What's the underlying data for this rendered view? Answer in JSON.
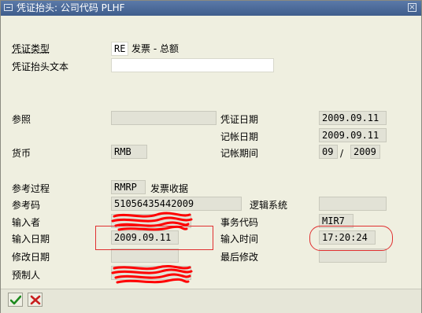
{
  "window": {
    "title": "凭证抬头: 公司代码 PLHF"
  },
  "fields": {
    "doc_type": {
      "label": "凭证类型",
      "value": "RE",
      "desc": "发票 - 总额"
    },
    "header_text": {
      "label": "凭证抬头文本",
      "value": ""
    },
    "reference": {
      "label": "参照",
      "value": ""
    },
    "doc_date": {
      "label": "凭证日期",
      "value": "2009.09.11"
    },
    "posting_date": {
      "label": "记帐日期",
      "value": "2009.09.11"
    },
    "currency": {
      "label": "货币",
      "value": "RMB"
    },
    "period": {
      "label": "记帐期间",
      "month": "09",
      "sep": "/",
      "year": "2009"
    },
    "ref_process": {
      "label": "参考过程",
      "value": "RMRP",
      "desc": "发票收据"
    },
    "ref_key": {
      "label": "参考码",
      "value": "51056435442009"
    },
    "logical_system": {
      "label": "逻辑系统",
      "value": ""
    },
    "entered_by": {
      "label": "输入者",
      "value": ""
    },
    "tcode": {
      "label": "事务代码",
      "value": "MIR7"
    },
    "entry_date": {
      "label": "输入日期",
      "value": "2009.09.11"
    },
    "entry_time": {
      "label": "输入时间",
      "value": "17:20:24"
    },
    "changed_on": {
      "label": "修改日期",
      "value": ""
    },
    "last_change": {
      "label": "最后修改",
      "value": ""
    },
    "parked_by": {
      "label": "预制人",
      "value": ""
    }
  },
  "buttons": {
    "confirm": "check-icon",
    "cancel": "cancel-icon"
  },
  "colors": {
    "title_bar": "#4a6a9a",
    "window_bg": "#efefe0",
    "highlight": "#e03030",
    "scribble": "#ff0000"
  }
}
